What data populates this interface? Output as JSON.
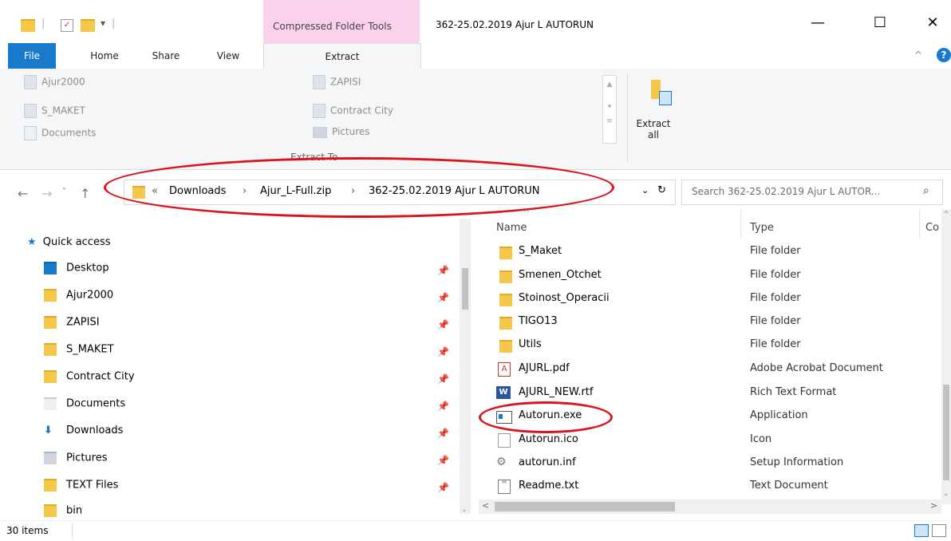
{
  "titlebar": {
    "context_header": "Compressed Folder Tools",
    "window_title": "362-25.02.2019 Ajur L AUTORUN",
    "minimize": "—",
    "maximize": "☐",
    "close": "✕"
  },
  "tabs": {
    "file": "File",
    "home": "Home",
    "share": "Share",
    "view": "View",
    "extract": "Extract"
  },
  "ribbon": {
    "destinations": [
      "Ajur2000",
      "S_MAKET",
      "Documents",
      "ZAPISI",
      "Contract City",
      "Pictures"
    ],
    "group_label": "Extract To",
    "extract_all": "Extract all"
  },
  "address": {
    "crumbs": [
      "Downloads",
      "Ajur_L-Full.zip",
      "362-25.02.2019 Ajur L AUTORUN"
    ],
    "search_placeholder": "Search 362-25.02.2019 Ajur L AUTOR..."
  },
  "nav": {
    "quick_access": "Quick access",
    "items": [
      "Desktop",
      "Ajur2000",
      "ZAPISI",
      "S_MAKET",
      "Contract City",
      "Documents",
      "Downloads",
      "Pictures",
      "TEXT Files",
      "bin"
    ]
  },
  "list": {
    "headers": {
      "name": "Name",
      "type": "Type",
      "col3": "Co"
    },
    "rows": [
      {
        "name": "S_Maket",
        "type": "File folder"
      },
      {
        "name": "Smenen_Otchet",
        "type": "File folder"
      },
      {
        "name": "Stoinost_Operacii",
        "type": "File folder"
      },
      {
        "name": "TIGO13",
        "type": "File folder"
      },
      {
        "name": "Utils",
        "type": "File folder"
      },
      {
        "name": "AJURL.pdf",
        "type": "Adobe Acrobat Document"
      },
      {
        "name": "AJURL_NEW.rtf",
        "type": "Rich Text Format"
      },
      {
        "name": "Autorun.exe",
        "type": "Application"
      },
      {
        "name": "Autorun.ico",
        "type": "Icon"
      },
      {
        "name": "autorun.inf",
        "type": "Setup Information"
      },
      {
        "name": "Readme.txt",
        "type": "Text Document"
      }
    ]
  },
  "status": {
    "items_count": "30 items"
  }
}
